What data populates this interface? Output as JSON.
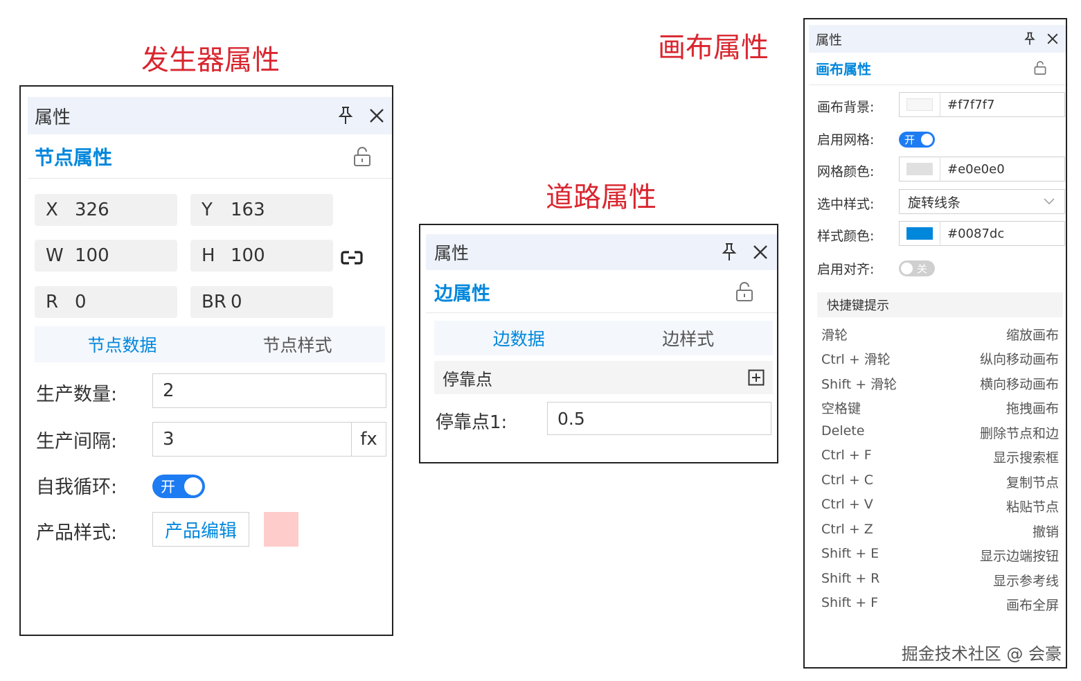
{
  "captions": {
    "generator": "发生器属性",
    "road": "道路属性",
    "canvas": "画布属性"
  },
  "generator_panel": {
    "header_title": "属性",
    "section_title": "节点属性",
    "fields": [
      {
        "key": "X",
        "value": "326"
      },
      {
        "key": "Y",
        "value": "163"
      },
      {
        "key": "W",
        "value": "100"
      },
      {
        "key": "H",
        "value": "100"
      },
      {
        "key": "R",
        "value": "0"
      },
      {
        "key": "BR",
        "value": "0"
      }
    ],
    "tabs": [
      {
        "label": "节点数据",
        "active": true
      },
      {
        "label": "节点样式",
        "active": false
      }
    ],
    "production_count_label": "生产数量:",
    "production_count_value": "2",
    "production_interval_label": "生产间隔:",
    "production_interval_value": "3",
    "fx_label": "fx",
    "self_loop_label": "自我循环:",
    "self_loop_toggle": "开",
    "product_style_label": "产品样式:",
    "product_edit_button": "产品编辑",
    "product_color": "#ffcccc"
  },
  "road_panel": {
    "header_title": "属性",
    "section_title": "边属性",
    "tabs": [
      {
        "label": "边数据",
        "active": true
      },
      {
        "label": "边样式",
        "active": false
      }
    ],
    "dock_section": "停靠点",
    "dock_label": "停靠点1:",
    "dock_value": "0.5"
  },
  "canvas_panel": {
    "header_title": "属性",
    "section_title": "画布属性",
    "bg_label": "画布背景:",
    "bg_value": "#f7f7f7",
    "grid_enable_label": "启用网格:",
    "grid_enable_toggle": "开",
    "grid_color_label": "网格颜色:",
    "grid_color_value": "#e0e0e0",
    "select_style_label": "选中样式:",
    "select_style_value": "旋转线条",
    "style_color_label": "样式颜色:",
    "style_color_value": "#0087dc",
    "align_label": "启用对齐:",
    "align_toggle": "关",
    "shortcut_title": "快捷键提示",
    "shortcuts": [
      {
        "key": "滑轮",
        "action": "缩放画布"
      },
      {
        "key": "Ctrl + 滑轮",
        "action": "纵向移动画布"
      },
      {
        "key": "Shift + 滑轮",
        "action": "横向移动画布"
      },
      {
        "key": "空格键",
        "action": "拖拽画布"
      },
      {
        "key": "Delete",
        "action": "删除节点和边"
      },
      {
        "key": "Ctrl + F",
        "action": "显示搜索框"
      },
      {
        "key": "Ctrl + C",
        "action": "复制节点"
      },
      {
        "key": "Ctrl + V",
        "action": "粘贴节点"
      },
      {
        "key": "Ctrl + Z",
        "action": "撤销"
      },
      {
        "key": "Shift + E",
        "action": "显示边端按钮"
      },
      {
        "key": "Shift + R",
        "action": "显示参考线"
      },
      {
        "key": "Shift + F",
        "action": "画布全屏"
      }
    ]
  },
  "watermark": "掘金技术社区 @ 会豪",
  "colors": {
    "accent": "#0087dc",
    "caption_red": "#d9262f",
    "toggle_on": "#1e7cf2",
    "header_bg": "#eef2fa"
  }
}
